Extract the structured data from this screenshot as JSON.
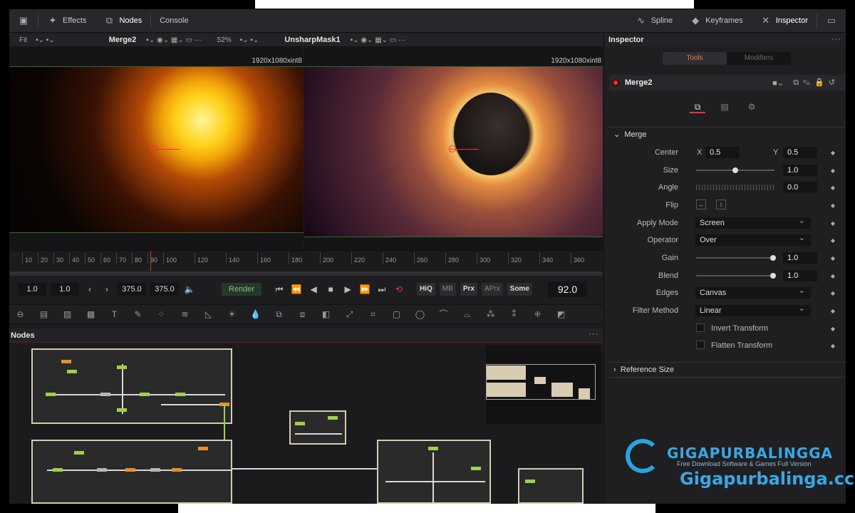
{
  "topbar": {
    "effects": "Effects",
    "nodes": "Nodes",
    "console": "Console",
    "spline": "Spline",
    "keyframes": "Keyframes",
    "inspector": "Inspector"
  },
  "viewer_left": {
    "fit": "Fit",
    "title": "Merge2",
    "zoom": "52%",
    "resolution": "1920x1080xint8"
  },
  "viewer_right": {
    "title": "UnsharpMask1",
    "resolution": "1920x1080xint8"
  },
  "ruler": {
    "ticks": [
      "10",
      "20",
      "30",
      "40",
      "50",
      "60",
      "70",
      "80",
      "90",
      "100",
      "120",
      "140",
      "160",
      "180",
      "200",
      "220",
      "240",
      "260",
      "280",
      "300",
      "320",
      "340",
      "360"
    ]
  },
  "transport": {
    "in": "1.0",
    "current": "1.0",
    "end": "375.0",
    "out": "375.0",
    "render": "Render",
    "hiq": "HiQ",
    "mb": "MB",
    "prx": "Prx",
    "aprx": "APrx",
    "some": "Some",
    "frame": "92.0"
  },
  "nodes_panel": {
    "title": "Nodes"
  },
  "inspector": {
    "title": "Inspector",
    "tab_tools": "Tools",
    "tab_modifiers": "Modifiers",
    "tool_name": "Merge2",
    "section": "Merge",
    "center_label": "Center",
    "center_x_label": "X",
    "center_x": "0.5",
    "center_y_label": "Y",
    "center_y": "0.5",
    "size_label": "Size",
    "size": "1.0",
    "angle_label": "Angle",
    "angle": "0.0",
    "flip_label": "Flip",
    "apply_mode_label": "Apply Mode",
    "apply_mode": "Screen",
    "operator_label": "Operator",
    "operator": "Over",
    "gain_label": "Gain",
    "gain": "1.0",
    "blend_label": "Blend",
    "blend": "1.0",
    "edges_label": "Edges",
    "edges": "Canvas",
    "filter_label": "Filter Method",
    "filter": "Linear",
    "invert_transform": "Invert Transform",
    "flatten_transform": "Flatten Transform",
    "reference_size": "Reference Size"
  },
  "watermark": {
    "name": "GIGAPURBALINGGA",
    "sub": "Free Download Software & Games Full Version",
    "url": "Gigapurbalinga.cc"
  }
}
